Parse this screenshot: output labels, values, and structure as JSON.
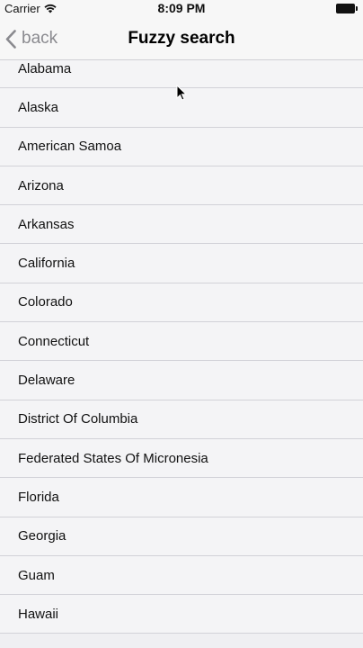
{
  "status_bar": {
    "carrier": "Carrier",
    "time": "8:09 PM",
    "wifi_icon": "wifi-icon",
    "battery_icon": "battery-icon"
  },
  "nav": {
    "back_label": "back",
    "back_icon": "chevron-left-icon",
    "title": "Fuzzy search"
  },
  "list": {
    "items": [
      "Alabama",
      "Alaska",
      "American Samoa",
      "Arizona",
      "Arkansas",
      "California",
      "Colorado",
      "Connecticut",
      "Delaware",
      "District Of Columbia",
      "Federated States Of Micronesia",
      "Florida",
      "Georgia",
      "Guam",
      "Hawaii"
    ]
  },
  "colors": {
    "background": "#efeff2",
    "nav_background": "#f7f7f7",
    "back_tint": "#8a8a8f",
    "separator": "#d2d2d8"
  }
}
